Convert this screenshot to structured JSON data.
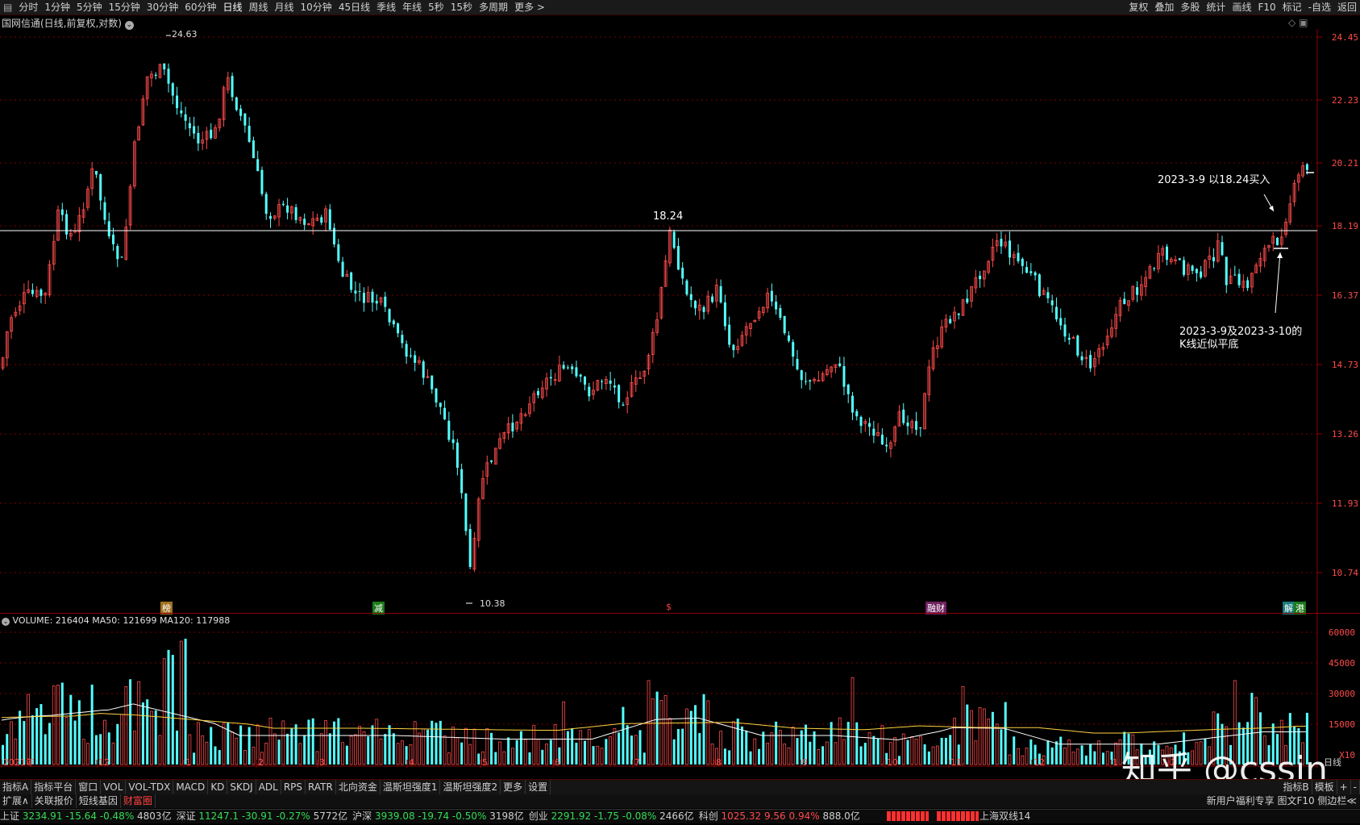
{
  "toolbar": {
    "periods": [
      "分时",
      "1分钟",
      "5分钟",
      "15分钟",
      "30分钟",
      "60分钟",
      "日线",
      "周线",
      "月线",
      "10分钟",
      "45日线",
      "季线",
      "年线",
      "5秒",
      "15秒",
      "多周期",
      "更多 >"
    ],
    "active_period": "日线",
    "right_buttons": [
      "复权",
      "叠加",
      "多股",
      "统计",
      "画线",
      "F10",
      "标记",
      "-自选",
      "返回"
    ]
  },
  "chart_title": "国网信通(日线,前复权,对数)",
  "price_axis": [
    "24.45",
    "22.23",
    "20.21",
    "18.19",
    "16.37",
    "14.73",
    "13.26",
    "11.93",
    "10.74"
  ],
  "volume_axis": [
    "60000",
    "45000",
    "30000",
    "15000",
    "X10"
  ],
  "volume_header": {
    "label": "VOLUME: 216404",
    "ma50": "MA50: 121699",
    "ma120": "MA120: 117988"
  },
  "x_axis_labels": [
    "2021年",
    "12",
    "1",
    "2",
    "3",
    "4",
    "5",
    "6",
    "7",
    "8",
    "9",
    "10",
    "11",
    "12",
    "1",
    "2"
  ],
  "x_axis_right": "日线",
  "annotations": {
    "high": "24.63",
    "low": "10.38",
    "level": "18.24",
    "buy_note": "2023-3-9 以18.24买入",
    "flat_note_1": "2023-3-9及2023-3-10的",
    "flat_note_2": "K线近似平底"
  },
  "event_tags": [
    "榜",
    "减",
    "$",
    "融财",
    "解",
    "港"
  ],
  "indicator_tabs": [
    "指标A",
    "指标平台",
    "窗口",
    "VOL",
    "VOL-TDX",
    "MACD",
    "KD",
    "SKDJ",
    "ADL",
    "RPS",
    "RATR",
    "北向资金",
    "温斯坦强度1",
    "温斯坦强度2",
    "更多",
    "设置"
  ],
  "indicator_right": [
    "指标B",
    "模板",
    "+",
    "-"
  ],
  "sub_tabs": [
    "扩展∧",
    "关联报价",
    "短线基因",
    "财富圈"
  ],
  "sub_right": "新用户福利专享 图文F10 侧边栏≪",
  "watermark": "知乎 @cssin",
  "status": [
    {
      "name": "上证",
      "price": "3234.91",
      "chg": "-15.64",
      "pct": "-0.48%",
      "amt": "4803亿"
    },
    {
      "name": "深证",
      "price": "11247.1",
      "chg": "-30.91",
      "pct": "-0.27%",
      "amt": "5772亿"
    },
    {
      "name": "沪深",
      "price": "3939.08",
      "chg": "-19.74",
      "pct": "-0.50%",
      "amt": "3198亿"
    },
    {
      "name": "创业",
      "price": "2291.92",
      "chg": "-1.75",
      "pct": "-0.08%",
      "amt": "2466亿"
    },
    {
      "name": "科创",
      "price": "1025.32",
      "chg": "9.56",
      "pct": "0.94%",
      "amt": "888.0亿"
    }
  ],
  "status_right": "上海双线14",
  "colors": {
    "up": "#ff4b4b",
    "down": "#54ffff",
    "ma": "#ffffff",
    "ma2": "#ffd23f",
    "grid": "#7a0000"
  }
}
